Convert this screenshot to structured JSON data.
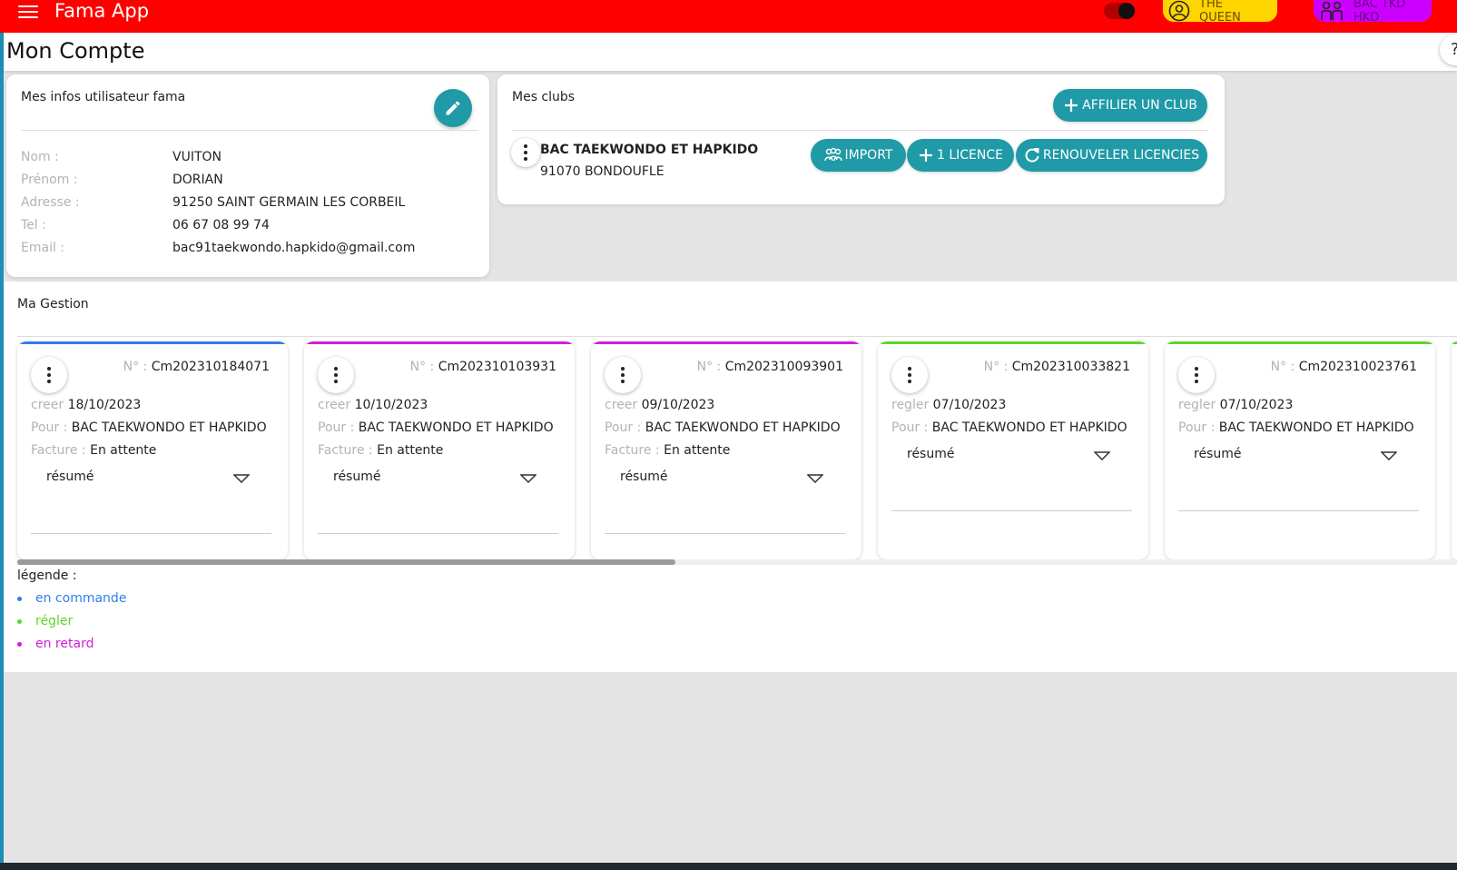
{
  "app": {
    "title": "Fama App"
  },
  "topbar": {
    "user_chip": "THE QUEEN",
    "club_chip": "BAC TKD HKD",
    "colors": {
      "bar": "#ff0000",
      "user_chip": "#ffd500",
      "club_chip": "#cc00ff"
    }
  },
  "page": {
    "title": "Mon Compte"
  },
  "user_info": {
    "title": "Mes infos utilisateur fama",
    "rows": [
      {
        "label": "Nom :",
        "value": "VUITON"
      },
      {
        "label": "Prénom :",
        "value": "DORIAN"
      },
      {
        "label": "Adresse :",
        "value": "91250 SAINT GERMAIN LES CORBEIL"
      },
      {
        "label": "Tel :",
        "value": "06 67 08 99 74"
      },
      {
        "label": "Email :",
        "value": "bac91taekwondo.hapkido@gmail.com"
      }
    ]
  },
  "clubs": {
    "title": "Mes clubs",
    "affiliate_label": "AFFILIER UN CLUB",
    "club": {
      "name": "BAC TAEKWONDO ET HAPKIDO",
      "city": "91070 BONDOUFLE"
    },
    "import_label": "IMPORT",
    "licence_label": "1 LICENCE",
    "renew_label": "RENOUVELER LICENCIES",
    "accent": "#1f9aa6"
  },
  "gestion": {
    "title": "Ma Gestion",
    "num_label": "N° :",
    "pour_label": "Pour :",
    "facture_label": "Facture :",
    "resume_label": "résumé",
    "orders": [
      {
        "num": "Cm202310184071",
        "status_word": "creer",
        "date": "18/10/2023",
        "pour": "BAC TAEKWONDO ET HAPKIDO",
        "facture": "En attente",
        "color": "#2f7fe8"
      },
      {
        "num": "Cm202310103931",
        "status_word": "creer",
        "date": "10/10/2023",
        "pour": "BAC TAEKWONDO ET HAPKIDO",
        "facture": "En attente",
        "color": "#d11ed8"
      },
      {
        "num": "Cm202310093901",
        "status_word": "creer",
        "date": "09/10/2023",
        "pour": "BAC TAEKWONDO ET HAPKIDO",
        "facture": "En attente",
        "color": "#d11ed8"
      },
      {
        "num": "Cm202310033821",
        "status_word": "regler",
        "date": "07/10/2023",
        "pour": "BAC TAEKWONDO ET HAPKIDO",
        "facture": "",
        "color": "#5ed62a"
      },
      {
        "num": "Cm202310023761",
        "status_word": "regler",
        "date": "07/10/2023",
        "pour": "BAC TAEKWONDO ET HAPKIDO",
        "facture": "",
        "color": "#5ed62a"
      }
    ]
  },
  "legend": {
    "title": "légende :",
    "items": [
      {
        "label": "en commande",
        "color": "#2f7fe8"
      },
      {
        "label": "régler",
        "color": "#5ed62a"
      },
      {
        "label": "en retard",
        "color": "#d11ed8"
      }
    ]
  }
}
